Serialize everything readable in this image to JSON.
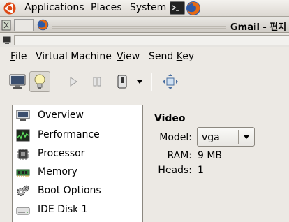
{
  "top_panel": {
    "applications": "Applications",
    "places": "Places",
    "system": "System"
  },
  "window": {
    "title": "Gmail - 편지"
  },
  "menubar": {
    "file_first": "F",
    "file_rest": "ile",
    "vm_label": "Virtual Machine",
    "view_first": "V",
    "view_rest": "iew",
    "sendkey_before": "Send ",
    "sendkey_mn": "K",
    "sendkey_after": "ey"
  },
  "hardware_list": [
    {
      "label": "Overview",
      "icon": "monitor-icon"
    },
    {
      "label": "Performance",
      "icon": "performance-graph-icon"
    },
    {
      "label": "Processor",
      "icon": "cpu-chip-icon"
    },
    {
      "label": "Memory",
      "icon": "memory-module-icon"
    },
    {
      "label": "Boot Options",
      "icon": "gears-icon"
    },
    {
      "label": "IDE Disk 1",
      "icon": "disk-drive-icon"
    }
  ],
  "detail": {
    "title": "Video",
    "model_label": "Model:",
    "model_value": "vga",
    "ram_label": "RAM:",
    "ram_value": "9 MB",
    "heads_label": "Heads:",
    "heads_value": "1"
  },
  "colors": {
    "panel_bg": "#dcd8d2",
    "window_bg": "#ece9e4",
    "list_bg": "#ffffff",
    "ubuntu_orange": "#dd4814"
  }
}
